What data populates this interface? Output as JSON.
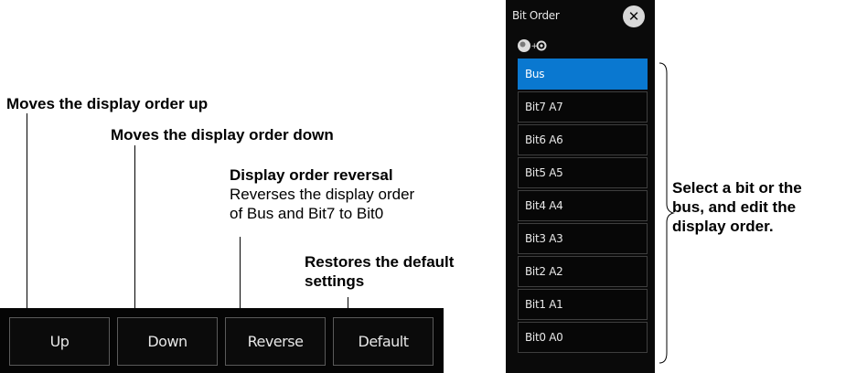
{
  "annotations": {
    "up": "Moves the display order up",
    "down": "Moves the display order down",
    "reverse_title": "Display order reversal",
    "reverse_line1": "Reverses the display order",
    "reverse_line2": "of Bus and Bit7 to Bit0",
    "default_line1": "Restores the default",
    "default_line2": "settings",
    "select_line1": "Select a bit or the",
    "select_line2": "bus, and edit the",
    "select_line3": "display order."
  },
  "softkeys": {
    "up": "Up",
    "down": "Down",
    "reverse": "Reverse",
    "default": "Default"
  },
  "panel": {
    "title": "Bit Order",
    "close_icon": "close-icon",
    "knob_icon": "jog-knob-push-icon",
    "items": [
      "Bus",
      "Bit7 A7",
      "Bit6 A6",
      "Bit5 A5",
      "Bit4 A4",
      "Bit3 A3",
      "Bit2 A2",
      "Bit1 A1",
      "Bit0 A0"
    ],
    "selected_index": 0
  },
  "colors": {
    "panel_bg": "#0a0a0a",
    "selected": "#0a78d0",
    "softkey_border": "#5a5a5a"
  }
}
